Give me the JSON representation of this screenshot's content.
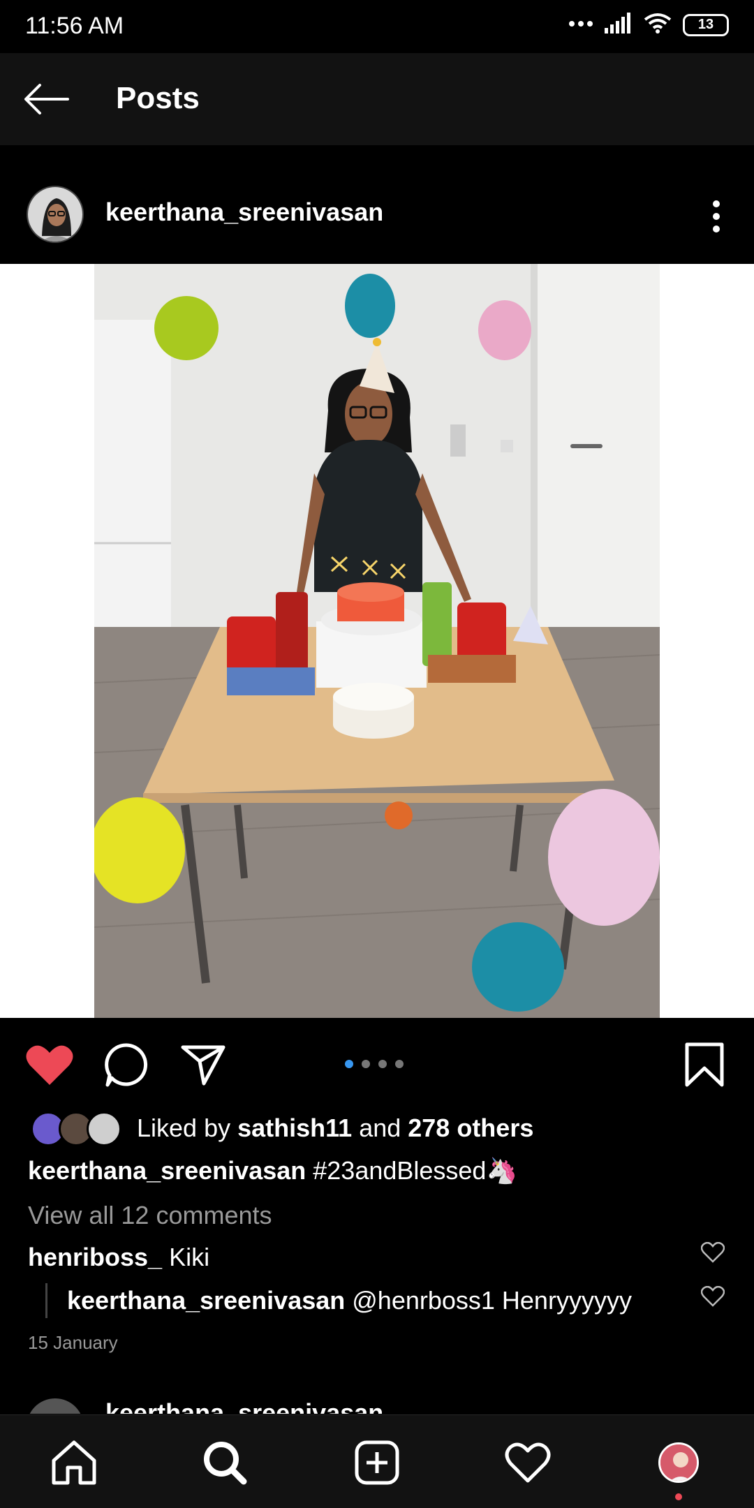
{
  "status": {
    "time": "11:56 AM",
    "battery": "13"
  },
  "header": {
    "title": "Posts"
  },
  "post": {
    "username": "keerthana_sreenivasan",
    "carousel": {
      "count": 4,
      "active_index": 0
    },
    "likes": {
      "prefix": "Liked by ",
      "user": "sathish11",
      "middle": " and ",
      "others": "278 others"
    },
    "caption": {
      "username": "keerthana_sreenivasan",
      "text": " #23andBlessed🦄"
    },
    "view_comments": "View all 12 comments",
    "comments": [
      {
        "username": "henriboss_",
        "text": " Kiki"
      },
      {
        "username": "keerthana_sreenivasan",
        "text": " @henrboss1 Henryyyyyy"
      }
    ],
    "date": "15 January"
  },
  "next_post": {
    "username": "keerthana_sreenivasan"
  },
  "colors": {
    "like_red": "#ed4956",
    "accent_blue": "#3897f0",
    "background": "#000000",
    "bar": "#121212"
  }
}
